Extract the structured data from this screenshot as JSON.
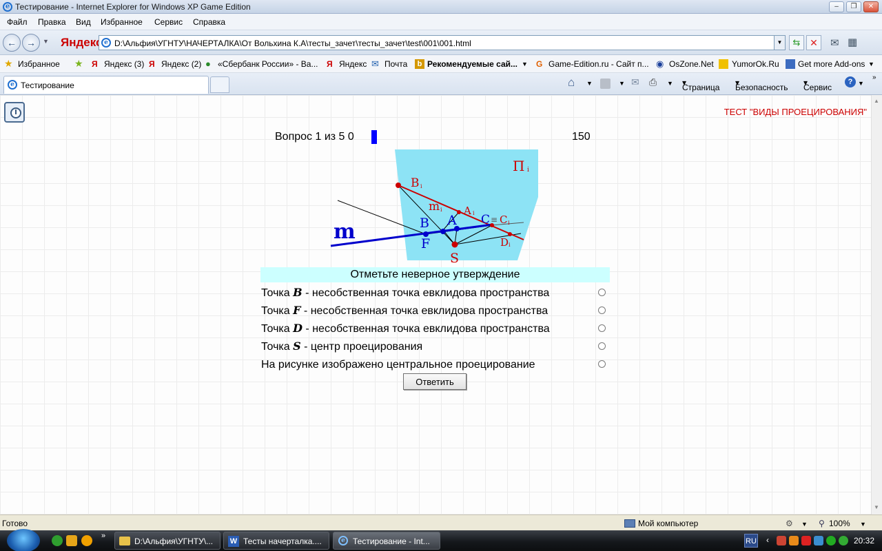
{
  "window": {
    "title": "Тестирование - Internet Explorer for Windows XP Game Edition"
  },
  "menu": [
    "Файл",
    "Правка",
    "Вид",
    "Избранное",
    "Сервис",
    "Справка"
  ],
  "address": {
    "brand": "Яндекс",
    "url": "D:\\Альфия\\УГНТУ\\НАЧЕРТАЛКА\\От Вольхина К.А\\тесты_зачет\\тесты_зачет\\test\\001\\001.html"
  },
  "favorites": {
    "label": "Избранное",
    "links": [
      "Яндекс (3)",
      "Яндекс (2)",
      "«Сбербанк России» - Ва...",
      "Яндекс",
      "Почта",
      "Рекомендуемые сай...",
      "Game-Edition.ru - Сайт п...",
      "OsZone.Net",
      "YumorOk.Ru",
      "Get more Add-ons"
    ]
  },
  "tabs": {
    "active": "Тестирование"
  },
  "commands": {
    "page": "Страница",
    "security": "Безопасность",
    "tools": "Сервис"
  },
  "test": {
    "title": "ТЕСТ \"ВИДЫ ПРОЕЦИРОВАНИЯ\"",
    "counter": "Вопрос 1 из 5",
    "score": "0",
    "timer": "150",
    "prompt": "Отметьте неверное утверждение",
    "options": [
      {
        "pre": "Точка ",
        "letter": "B",
        "post": " - несобственная точка евклидова пространства"
      },
      {
        "pre": "Точка ",
        "letter": "F",
        "post": " - несобственная точка евклидова пространства"
      },
      {
        "pre": "Точка ",
        "letter": "D",
        "post": " - несобственная точка евклидова пространства"
      },
      {
        "pre": "Точка ",
        "letter": "S",
        "post": " - центр проецирования"
      },
      {
        "pre": "",
        "letter": "",
        "post": "На рисунке изображено центральное проецирование"
      }
    ],
    "answer_button": "Ответить"
  },
  "diagram": {
    "plane_label": "П",
    "plane_sub": "i",
    "points": {
      "B1": "B",
      "B1sub": "i",
      "m1": "m",
      "m1sub": "i",
      "A1": "A",
      "A1sub": "i",
      "C1": "C",
      "eq": "≡",
      "C1b": "C",
      "C1sub": "i",
      "D1": "D",
      "D1sub": "i",
      "m": "m",
      "B": "B",
      "A": "A",
      "F": "F",
      "S": "S"
    },
    "colors": {
      "plane": "#8de3f5",
      "red": "#cc0000",
      "blue": "#0000cc"
    }
  },
  "status": {
    "text": "Готово",
    "zone": "Мой компьютер",
    "zoom": "100%"
  },
  "taskbar": {
    "items": [
      "D:\\Альфия\\УГНТУ\\...",
      "Тесты начерталка....",
      "Тестирование - Int..."
    ],
    "lang": "RU",
    "clock": "20:32"
  }
}
